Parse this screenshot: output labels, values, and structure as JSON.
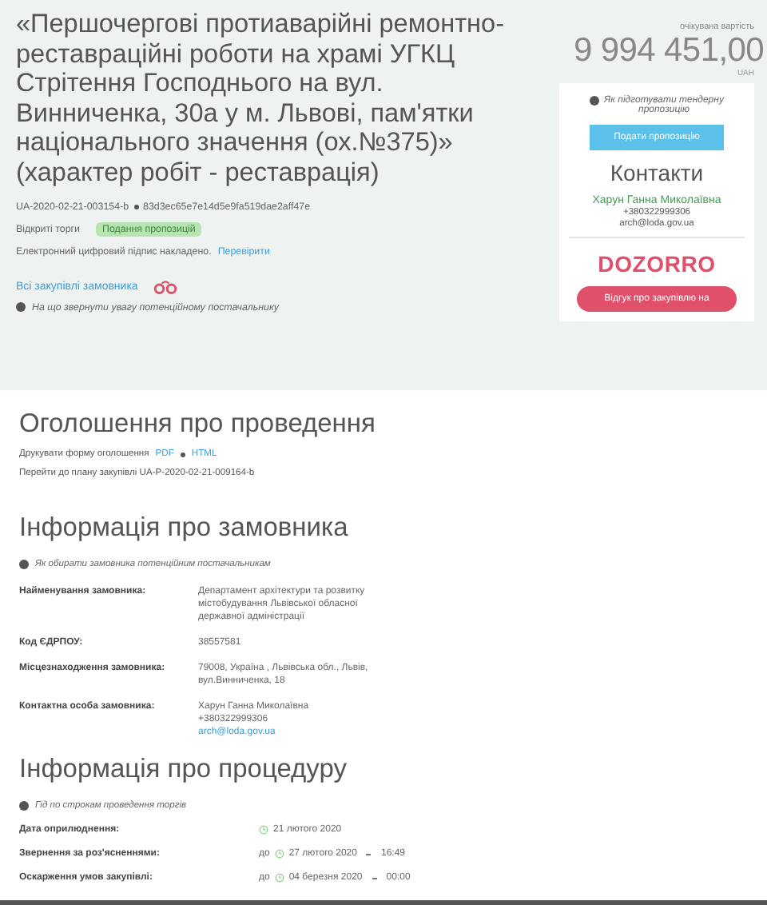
{
  "tender": {
    "title": "«Першочергові протиаварійні ремонтно-реставраційні роботи на храмі УГКЦ Стрітення Господнього на вул. Винниченка, 30а у м. Львові, пам'ятки національного значення (ох.№375)» (характер робіт - реставрація)",
    "tender_id": "UA-2020-02-21-003154-b",
    "hash": "83d3ec65e7e14d5e9fa519dae2aff47e",
    "procedure": "Відкриті торги",
    "status": "Подання пропозицій",
    "signature_text": "Електронний цифровий підпис накладено.",
    "signature_link": "Перевірити",
    "all_purchases_link": "Всі закупівлі замовника",
    "hint": "На що звернути увагу потенційному постачальнику"
  },
  "sidebar": {
    "value_label": "очікувана вартість",
    "value": "9 994 451,00",
    "currency": "UAH",
    "help": "Як підготувати тендерну пропозицію",
    "submit_button": "Подати пропозицію",
    "contacts_title": "Контакти",
    "contact_name": "Харун Ганна Миколаївна",
    "phone": "+380322999306",
    "email": "arch@loda.gov.ua",
    "logo": "DOZORRO",
    "feedback_button": "Відгук про закупівлю на"
  },
  "announcement": {
    "title": "Оголошення про проведення",
    "print_label": "Друкувати форму оголошення",
    "print_links": [
      "PDF",
      "HTML"
    ],
    "plan_link": "Перейти до плану закупівлі UA-P-2020-02-21-009164-b"
  },
  "customer": {
    "title": "Інформація про замовника",
    "hint": "Як обирати замовника потенційним постачальникам",
    "rows": [
      {
        "label": "Найменування замовника:",
        "lines": [
          "Департамент архітектури та розвитку містобудування Львівської обласної державної адміністрації"
        ]
      },
      {
        "label": "Код ЄДРПОУ:",
        "lines": [
          "38557581"
        ]
      },
      {
        "label": "Місцезнаходження замовника:",
        "lines": [
          "79008, Україна , Львівська обл., Львів, вул.Винниченка, 18"
        ]
      },
      {
        "label": "Контактна особа замовника:",
        "lines": [
          "Харун Ганна Миколаївна",
          "+380322999306"
        ],
        "link": "arch@loda.gov.ua"
      }
    ]
  },
  "procedure": {
    "title": "Інформація про процедуру",
    "hint": "Гід по строкам проведення торгів",
    "rows": [
      {
        "label": "Дата оприлюднення:",
        "date": "21 лютого 2020"
      },
      {
        "label": "Звернення за роз'ясненнями:",
        "prefix": "до",
        "date": "27 лютого 2020",
        "time": "16:49"
      },
      {
        "label": "Оскарження умов закупівлі:",
        "prefix": "до",
        "date": "04 березня 2020",
        "time": "00:00"
      }
    ]
  }
}
